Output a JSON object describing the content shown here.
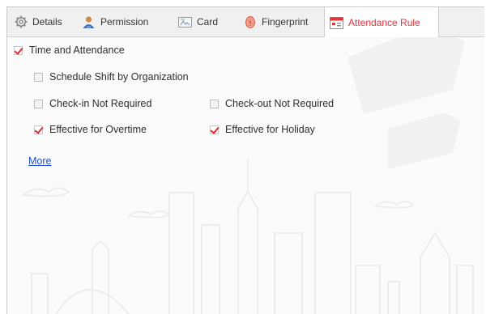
{
  "tabs": [
    {
      "label": "Details",
      "icon": "gear-icon",
      "active": false
    },
    {
      "label": "Permission",
      "icon": "user-icon",
      "active": false
    },
    {
      "label": "Card",
      "icon": "card-icon",
      "active": false
    },
    {
      "label": "Fingerprint",
      "icon": "fingerprint-icon",
      "active": false
    },
    {
      "label": "Attendance Rule",
      "icon": "calendar-icon",
      "active": true
    }
  ],
  "attendance": {
    "time_and_attendance": {
      "label": "Time and Attendance",
      "checked": true
    },
    "schedule_shift": {
      "label": "Schedule Shift by Organization",
      "checked": false
    },
    "checkin_not_required": {
      "label": "Check-in Not Required",
      "checked": false
    },
    "checkout_not_required": {
      "label": "Check-out Not Required",
      "checked": false
    },
    "effective_overtime": {
      "label": "Effective for Overtime",
      "checked": true
    },
    "effective_holiday": {
      "label": "Effective for Holiday",
      "checked": true
    },
    "more_link": "More"
  },
  "colors": {
    "accent": "#e0353d",
    "link": "#1f4fd6"
  }
}
